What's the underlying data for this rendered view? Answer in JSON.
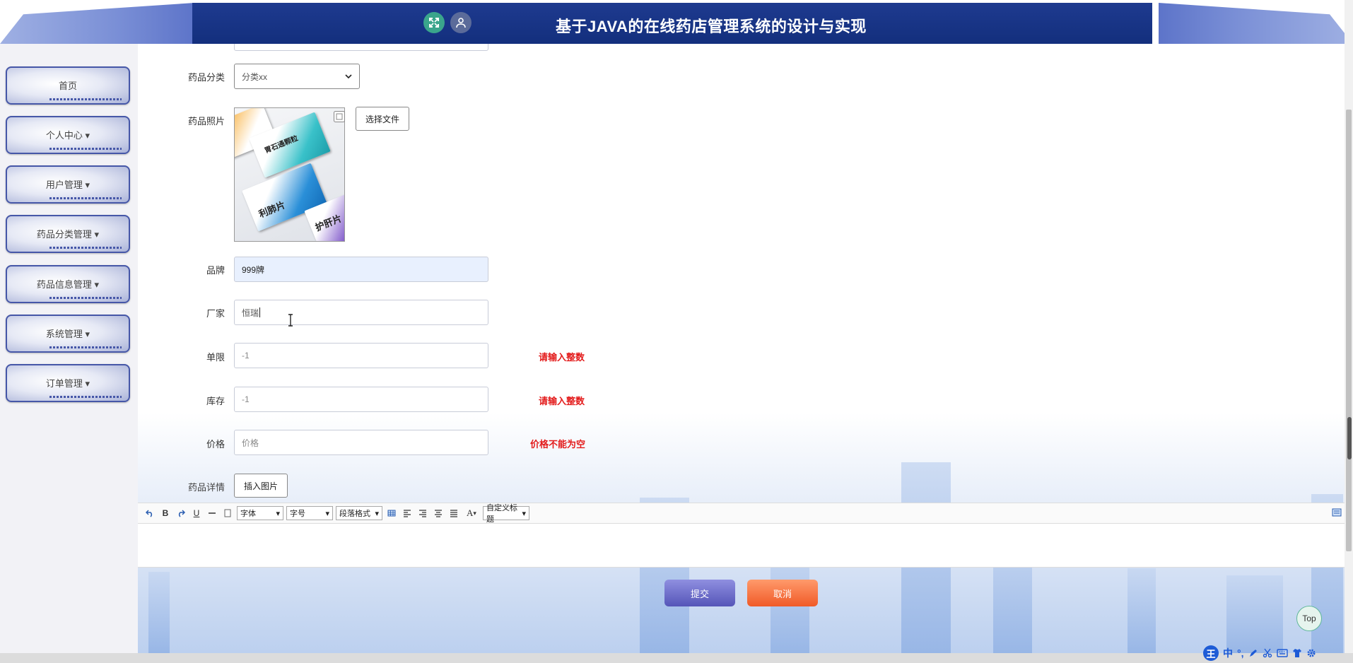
{
  "header": {
    "title": "基于JAVA的在线药店管理系统的设计与实现"
  },
  "sidebar": {
    "items": [
      {
        "label": "首页"
      },
      {
        "label": "个人中心 ▾"
      },
      {
        "label": "用户管理 ▾"
      },
      {
        "label": "药品分类管理 ▾"
      },
      {
        "label": "药品信息管理 ▾"
      },
      {
        "label": "系统管理 ▾"
      },
      {
        "label": "订单管理 ▾"
      }
    ]
  },
  "form": {
    "category": {
      "label": "药品分类",
      "value": "分类xx"
    },
    "photo": {
      "label": "药品照片",
      "choose_file": "选择文件",
      "box_texts": [
        "胃石通颗粒",
        "利肺片",
        "护肝片"
      ]
    },
    "brand": {
      "label": "品牌",
      "value": "999牌"
    },
    "maker": {
      "label": "厂家",
      "value": "恒瑞"
    },
    "limit": {
      "label": "单限",
      "value": "-1",
      "error": "请输入整数"
    },
    "stock": {
      "label": "库存",
      "value": "-1",
      "error": "请输入整数"
    },
    "price": {
      "label": "价格",
      "placeholder": "价格",
      "error": "价格不能为空"
    },
    "detail": {
      "label": "药品详情",
      "insert_image": "插入图片"
    }
  },
  "editor": {
    "font_family": "字体",
    "font_size": "字号",
    "paragraph": "段落格式",
    "font_color": "A",
    "custom_heading": "自定义标题",
    "bold": "B",
    "underline": "U"
  },
  "actions": {
    "submit": "提交",
    "cancel": "取消",
    "top": "Top"
  },
  "ime": {
    "logo": "王",
    "lang": "中"
  },
  "colors": {
    "header_bg": "#132f7d",
    "error": "#e31b1b",
    "submit": "#6a6ac8",
    "cancel": "#f47040"
  }
}
